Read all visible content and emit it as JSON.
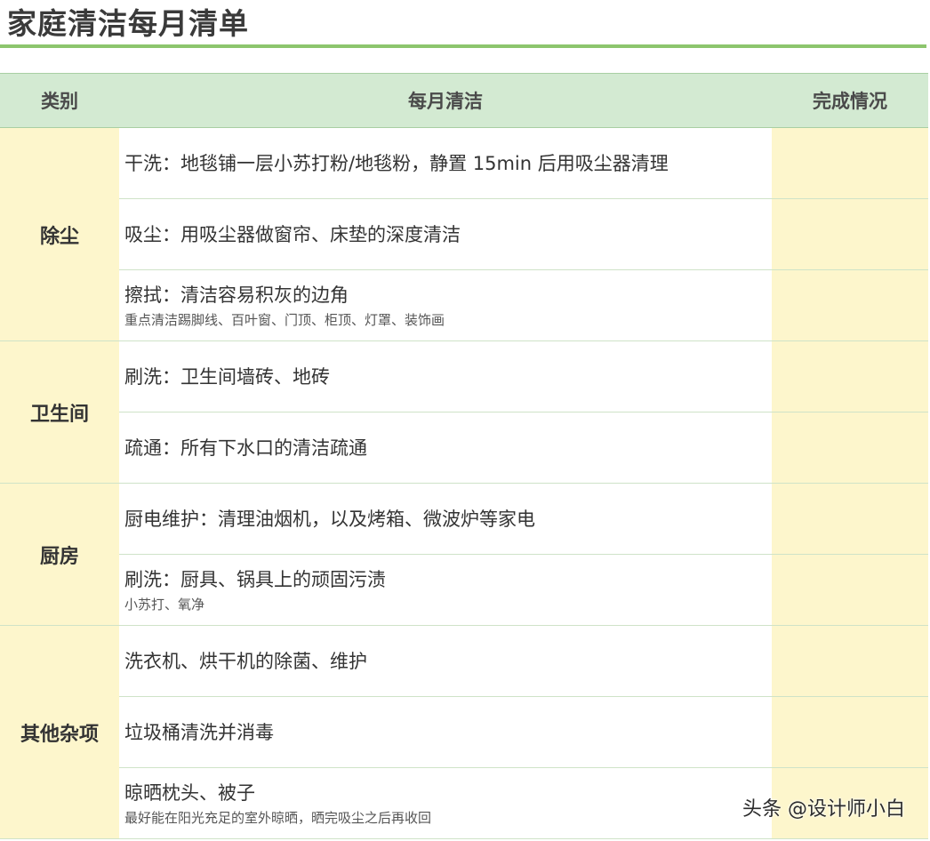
{
  "title": "家庭清洁每月清单",
  "headers": {
    "category": "类别",
    "task": "每月清洁",
    "status": "完成情况"
  },
  "groups": [
    {
      "category": "除尘",
      "items": [
        {
          "main": "干洗：地毯铺一层小苏打粉/地毯粉，静置 15min 后用吸尘器清理",
          "note": ""
        },
        {
          "main": "吸尘：用吸尘器做窗帘、床垫的深度清洁",
          "note": ""
        },
        {
          "main": "擦拭：清洁容易积灰的边角",
          "note": "重点清洁踢脚线、百叶窗、门顶、柜顶、灯罩、装饰画"
        }
      ]
    },
    {
      "category": "卫生间",
      "items": [
        {
          "main": "刷洗：卫生间墙砖、地砖",
          "note": ""
        },
        {
          "main": "疏通：所有下水口的清洁疏通",
          "note": ""
        }
      ]
    },
    {
      "category": "厨房",
      "items": [
        {
          "main": "厨电维护：清理油烟机，以及烤箱、微波炉等家电",
          "note": ""
        },
        {
          "main": "刷洗：厨具、锅具上的顽固污渍",
          "note": "小苏打、氧净"
        }
      ]
    },
    {
      "category": "其他杂项",
      "items": [
        {
          "main": "洗衣机、烘干机的除菌、维护",
          "note": ""
        },
        {
          "main": "垃圾桶清洗并消毒",
          "note": ""
        },
        {
          "main": "晾晒枕头、被子",
          "note": "最好能在阳光充足的室外晾晒，晒完吸尘之后再收回"
        }
      ]
    }
  ],
  "watermark": "头条 @设计师小白",
  "colors": {
    "accent_green": "#8cc56d",
    "header_bg": "#d3ead2",
    "highlight_yellow": "#fdf6cc"
  }
}
